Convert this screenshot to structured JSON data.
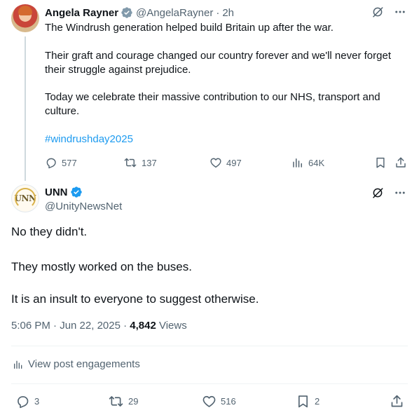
{
  "parent_tweet": {
    "author_name": "Angela Rayner",
    "handle": "@AngelaRayner",
    "separator": "·",
    "time": "2h",
    "paragraphs": [
      "The Windrush generation helped build Britain up after the war.",
      "Their graft and courage changed our country forever and we'll never forget",
      "their struggle against prejudice.",
      "Today we celebrate their massive contribution to our NHS, transport and",
      "culture."
    ],
    "hashtag": "#windrushday2025",
    "actions": {
      "replies": "577",
      "reposts": "137",
      "likes": "497",
      "views": "64K"
    }
  },
  "reply_tweet": {
    "author_name": "UNN",
    "handle": "@UnityNewsNet",
    "avatar_text": "UNN",
    "lines": [
      "No they didn't.",
      "They mostly worked on the buses.",
      "It is an insult to everyone to suggest otherwise."
    ],
    "timestamp": "5:06 PM · Jun 22, 2025 · ",
    "views_count": "4,842",
    "views_label": " Views",
    "engagements_link": "View post engagements",
    "actions": {
      "replies": "3",
      "reposts": "29",
      "likes": "516",
      "bookmarks": "2"
    }
  },
  "colors": {
    "text": "#0f1419",
    "secondary": "#536471",
    "link": "#1d9bf0",
    "verified": "#1d9bf0",
    "divider": "#eff3f4",
    "thread_line": "#cfd9de"
  },
  "icons": [
    "verified-badge-icon",
    "grok-icon",
    "more-icon",
    "reply-icon",
    "repost-icon",
    "like-icon",
    "views-icon",
    "bookmark-icon",
    "share-icon",
    "engagements-icon"
  ]
}
